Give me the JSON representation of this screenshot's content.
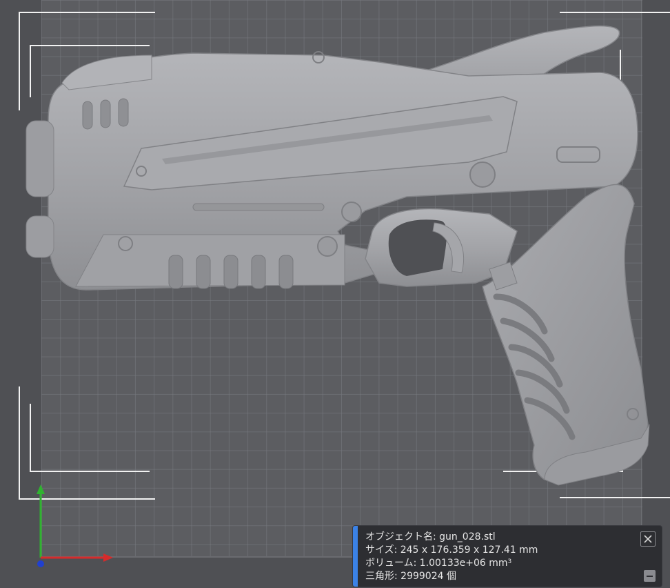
{
  "viewport": {
    "background_color": "#4f5054",
    "bed_color": "#5c5d61",
    "grid_line_color": "#787a80",
    "bracket_color": "#f2f2f2",
    "model_color": "#a4a5a9"
  },
  "model": {
    "icon": "gun-model"
  },
  "axes": {
    "x_color": "#d62b2b",
    "y_color": "#2fb32f",
    "z_color": "#2040d0"
  },
  "info": {
    "object_name": "オブジェクト名: gun_028.stl",
    "size": "サイズ: 245 x 176.359 x 127.41 mm",
    "volume": "ボリューム: 1.00133e+06 mm",
    "volume_sup": "3",
    "triangles": "三角形: 2999024 個",
    "accent_color": "#3b82e6"
  }
}
